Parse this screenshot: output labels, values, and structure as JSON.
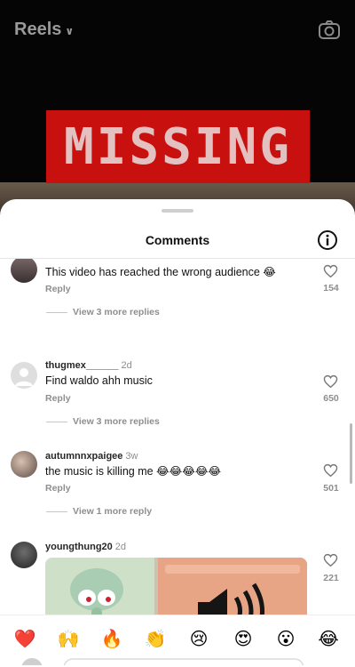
{
  "header": {
    "title": "Reels"
  },
  "video": {
    "overlay_text": "MISSING"
  },
  "sheet": {
    "title": "Comments"
  },
  "comments": [
    {
      "username": "",
      "age": "",
      "text": "This video has reached the wrong audience 😂",
      "reply_label": "Reply",
      "likes": "154",
      "view_replies": "View 3 more replies"
    },
    {
      "username": "thugmex______",
      "age": "2d",
      "text": "Find waldo ahh music",
      "reply_label": "Reply",
      "likes": "650",
      "view_replies": "View 3 more replies"
    },
    {
      "username": "autumnnxpaigee",
      "age": "3w",
      "text": "the music is killing me 😂😂😂😂😂",
      "reply_label": "Reply",
      "likes": "501",
      "view_replies": "View 1 more reply"
    },
    {
      "username": "youngthung20",
      "age": "2d",
      "text": "",
      "reply_label": "",
      "likes": "221",
      "view_replies": ""
    }
  ],
  "emoji_bar": [
    "❤️",
    "🙌",
    "🔥",
    "👏",
    "😢",
    "😍",
    "😮",
    "😂"
  ]
}
